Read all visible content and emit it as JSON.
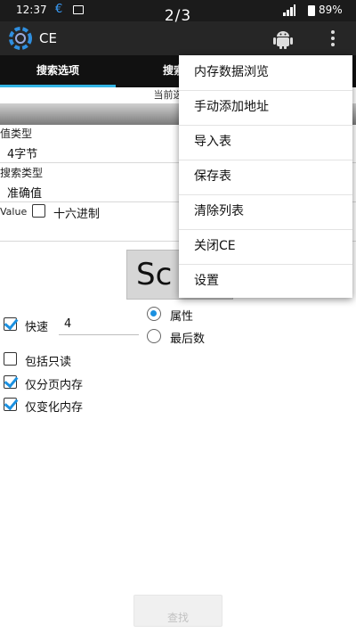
{
  "status_bar": {
    "time": "12:37",
    "battery": "89%"
  },
  "page_counter": "2/3",
  "action_bar": {
    "title": "CE"
  },
  "tabs": [
    {
      "label": "搜索选项"
    },
    {
      "label": "搜索"
    }
  ],
  "selected_strip": "当前选择进",
  "form": {
    "value_type_label": "值类型",
    "value_type_value": "4字节",
    "search_type_label": "搜索类型",
    "search_type_value": "准确值",
    "value_label": "Value",
    "hex_label": "十六进制",
    "scan_button_label": "Sc",
    "fast_label": "快速",
    "fast_value": "4",
    "radio_attr_label": "属性",
    "radio_last_label": "最后数",
    "include_readonly_label": "包括只读",
    "paged_memory_label": "仅分页内存",
    "changed_memory_label": "仅变化内存"
  },
  "menu": {
    "items": [
      {
        "label": "内存数据浏览"
      },
      {
        "label": "手动添加地址"
      },
      {
        "label": "导入表"
      },
      {
        "label": "保存表"
      },
      {
        "label": "清除列表"
      },
      {
        "label": "关闭CE"
      },
      {
        "label": "设置"
      }
    ]
  },
  "bottom_button": "查找"
}
